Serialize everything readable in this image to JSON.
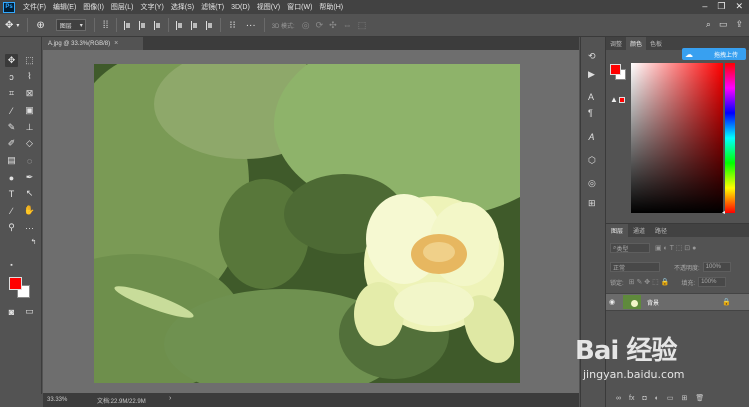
{
  "app": {
    "logo": "Ps"
  },
  "menu": [
    "文件(F)",
    "编辑(E)",
    "图像(I)",
    "图层(L)",
    "文字(Y)",
    "选择(S)",
    "滤镜(T)",
    "3D(D)",
    "视图(V)",
    "窗口(W)",
    "帮助(H)"
  ],
  "options": {
    "layer_select": "图层",
    "mode_3d": "3D 模式:"
  },
  "document": {
    "tab_title": "A.jpg @ 33.3%(RGB/8)",
    "zoom": "33.33%",
    "doc_size": "文档:22.9M/22.9M"
  },
  "color_panel": {
    "tabs": [
      "调整",
      "颜色",
      "色板"
    ],
    "upload_label": "拖拽上传",
    "foreground": "#ff0000",
    "background": "#ffffff"
  },
  "layers_panel": {
    "tabs": [
      "图层",
      "通道",
      "路径"
    ],
    "kind_filter": "类型",
    "blend_mode": "正常",
    "opacity_label": "不透明度:",
    "opacity_value": "100%",
    "lock_label": "锁定:",
    "fill_label": "填充:",
    "fill_value": "100%",
    "layers": [
      {
        "name": "背景",
        "visible": true,
        "locked": true
      }
    ]
  },
  "watermark": {
    "logo": "Bai 经验",
    "url": "jingyan.baidu.com"
  }
}
